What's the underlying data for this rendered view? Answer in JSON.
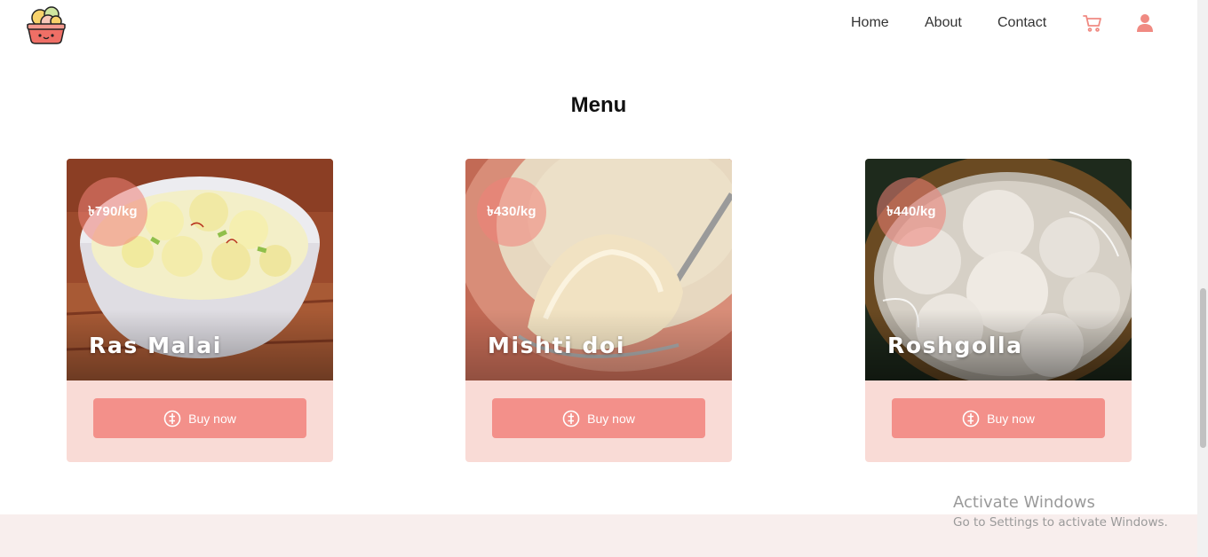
{
  "nav": {
    "links": [
      "Home",
      "About",
      "Contact"
    ],
    "cart_icon": "cart-icon",
    "user_icon": "user-icon"
  },
  "menu": {
    "title": "Menu",
    "items": [
      {
        "price": "৳790/kg",
        "name": "Ras Malai",
        "button": "Buy now",
        "button_icon": "coin-icon"
      },
      {
        "price": "৳430/kg",
        "name": "Mishti doi",
        "button": "Buy now",
        "button_icon": "coin-icon"
      },
      {
        "price": "৳440/kg",
        "name": "Roshgolla",
        "button": "Buy now",
        "button_icon": "coin-icon"
      }
    ]
  },
  "watermark": {
    "title": "Activate Windows",
    "subtitle": "Go to Settings to activate Windows."
  },
  "colors": {
    "accent": "#f3908a",
    "card_bg": "#f9dbd6",
    "footer_bg": "#f8eeed"
  }
}
